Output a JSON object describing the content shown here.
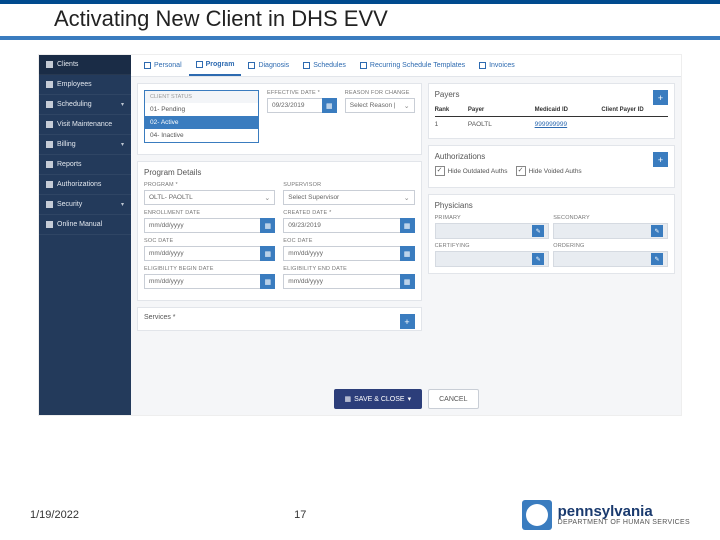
{
  "slide": {
    "title": "Activating New Client in DHS EVV",
    "date": "1/19/2022",
    "page": "17",
    "brand_name": "pennsylvania",
    "brand_dept": "DEPARTMENT OF HUMAN SERVICES"
  },
  "sidebar": {
    "items": [
      {
        "label": "Clients",
        "icon": "users-icon",
        "active": true
      },
      {
        "label": "Employees",
        "icon": "idcard-icon"
      },
      {
        "label": "Scheduling",
        "icon": "calendar-icon",
        "caret": true
      },
      {
        "label": "Visit Maintenance",
        "icon": "check-icon"
      },
      {
        "label": "Billing",
        "icon": "card-icon",
        "caret": true
      },
      {
        "label": "Reports",
        "icon": "chart-icon"
      },
      {
        "label": "Authorizations",
        "icon": "gear-icon"
      },
      {
        "label": "Security",
        "icon": "lock-icon",
        "caret": true
      },
      {
        "label": "Online Manual",
        "icon": "book-icon"
      }
    ]
  },
  "tabs": [
    {
      "label": "Personal"
    },
    {
      "label": "Program",
      "active": true
    },
    {
      "label": "Diagnosis"
    },
    {
      "label": "Schedules"
    },
    {
      "label": "Recurring Schedule Templates"
    },
    {
      "label": "Invoices"
    }
  ],
  "clientStatus": {
    "label": "Client Status",
    "options": [
      {
        "label": "01- Pending"
      },
      {
        "label": "02- Active",
        "selected": true
      },
      {
        "label": "04- Inactive"
      }
    ]
  },
  "topFields": {
    "effDate": {
      "label": "EFFECTIVE DATE *",
      "value": "09/23/2019"
    },
    "reason": {
      "label": "REASON FOR CHANGE",
      "value": "Select Reason | "
    }
  },
  "program": {
    "title": "Program Details",
    "program": {
      "label": "PROGRAM *",
      "value": "OLTL- PAOLTL"
    },
    "supervisor": {
      "label": "SUPERVISOR",
      "value": "Select Supervisor"
    },
    "enroll": {
      "label": "ENROLLMENT DATE",
      "value": "mm/dd/yyyy"
    },
    "created": {
      "label": "CREATED DATE *",
      "value": "09/23/2019"
    },
    "soc": {
      "label": "SOC DATE",
      "value": "mm/dd/yyyy"
    },
    "eoc": {
      "label": "EOC DATE",
      "value": "mm/dd/yyyy"
    },
    "ebegin": {
      "label": "ELIGIBILITY BEGIN DATE",
      "value": "mm/dd/yyyy"
    },
    "eend": {
      "label": "ELIGIBILITY END DATE",
      "value": "mm/dd/yyyy"
    }
  },
  "services": {
    "title": "Services *"
  },
  "payers": {
    "title": "Payers",
    "cols": [
      "Rank",
      "Payer",
      "Medicaid ID",
      "Client Payer ID"
    ],
    "rows": [
      {
        "rank": "1",
        "payer": "PAOLTL",
        "medicaid": "999999999",
        "cpid": ""
      }
    ]
  },
  "auth": {
    "title": "Authorizations",
    "hideOutdated": "Hide Outdated Auths",
    "hideVoided": "Hide Voided Auths"
  },
  "phys": {
    "title": "Physicians",
    "labels": {
      "primary": "PRIMARY",
      "secondary": "SECONDARY",
      "certifying": "CERTIFYING",
      "ordering": "ORDERING"
    }
  },
  "actions": {
    "save": "SAVE & CLOSE",
    "cancel": "CANCEL"
  }
}
